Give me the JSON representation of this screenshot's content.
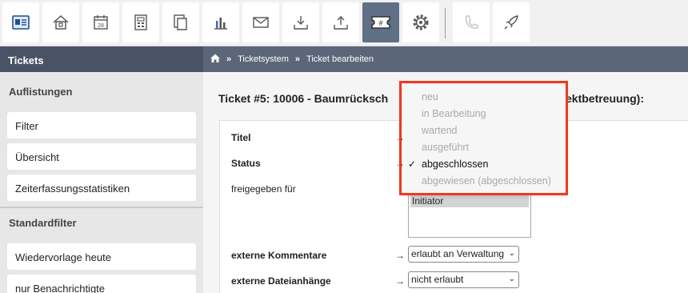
{
  "toolbar": {
    "buttons": [
      {
        "icon": "contact-card-icon"
      },
      {
        "icon": "home-icon"
      },
      {
        "icon": "calendar-icon",
        "label": "28"
      },
      {
        "icon": "calculator-icon"
      },
      {
        "icon": "documents-icon"
      },
      {
        "icon": "bar-chart-icon"
      },
      {
        "icon": "mail-icon"
      },
      {
        "icon": "download-tray-icon"
      },
      {
        "icon": "upload-tray-icon"
      },
      {
        "icon": "ticket-icon",
        "label": "#"
      },
      {
        "icon": "gear-icon"
      },
      {
        "icon": "phone-icon"
      },
      {
        "icon": "rocket-icon"
      }
    ]
  },
  "sidebar": {
    "header": "Tickets",
    "section1_title": "Auflistungen",
    "section1_items": [
      "Filter",
      "Übersicht",
      "Zeiterfassungsstatistiken"
    ],
    "section2_title": "Standardfilter",
    "section2_items": [
      "Wiedervorlage heute",
      "nur Benachrichtigte"
    ]
  },
  "breadcrumb": {
    "home_icon": "home-icon",
    "separator": "»",
    "items": [
      "Ticketsystem",
      "Ticket bearbeiten"
    ]
  },
  "main": {
    "title_visible_start": "Ticket #5: 10006 - Baumrücksch",
    "title_visible_end": "ektbetreuung):",
    "form": {
      "titel_label": "Titel",
      "status_label": "Status",
      "freigegeben_label": "freigegeben für",
      "freigegeben_selected_option": "Initiator",
      "externe_kommentare_label": "externe Kommentare",
      "externe_kommentare_value": "erlaubt an Verwaltung",
      "externe_dateianhaenge_label": "externe Dateianhänge",
      "externe_dateianhaenge_value": "nicht erlaubt",
      "arrow": "→"
    }
  },
  "status_dropdown": {
    "options": [
      "neu",
      "in Bearbeitung",
      "wartend",
      "ausgeführt",
      "abgeschlossen",
      "abgewiesen (abgeschlossen)"
    ],
    "selected": "abgeschlossen",
    "check": "✓"
  },
  "colors": {
    "highlight": "#f0391e",
    "sidebar_header": "#4a5366",
    "breadcrumb_bar": "#5c6679",
    "active_tool": "#5f6f85"
  }
}
